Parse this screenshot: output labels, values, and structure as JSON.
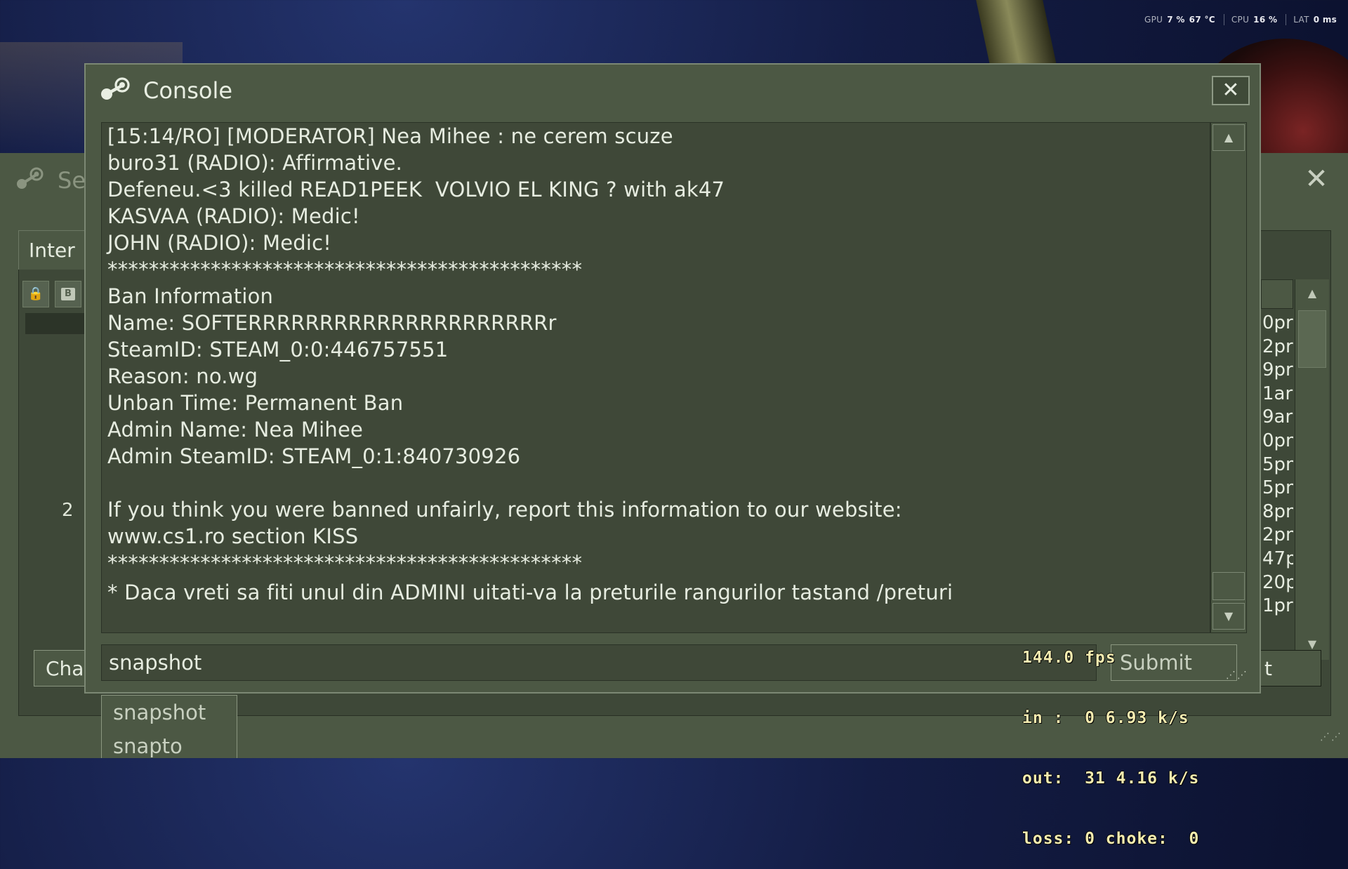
{
  "hud": {
    "gpu_label": "GPU",
    "gpu_value": "7 %",
    "gpu_temp": "67 °C",
    "cpu_label": "CPU",
    "cpu_value": "16 %",
    "lat_label": "LAT",
    "lat_value": "0 ms"
  },
  "server_browser": {
    "title": "Se",
    "tab_label": "Inter",
    "row_number": "2",
    "times": [
      "0pr",
      "2pr",
      "9pr",
      "1ar",
      "9ar",
      "0pn",
      "5pn",
      "5pn",
      "8pn",
      "2pn",
      "47p",
      "20p",
      "1pr"
    ],
    "left_button": "Cha",
    "right_button": "t"
  },
  "console": {
    "title": "Console",
    "close_icon": "close-icon",
    "lines": [
      "[15:14/RO] [MODERATOR] Nea Mihee : ne cerem scuze",
      "buro31 (RADIO): Affirmative.",
      "Defeneu.<3 killed READ1PEEK  VOLVIO EL KING ? with ak47",
      "KASVAA (RADIO): Medic!",
      "JOHN (RADIO): Medic!",
      "**********************************************",
      "Ban Information",
      "Name: SOFTERRRRRRRRRRRRRRRRRRRRRr",
      "SteamID: STEAM_0:0:446757551",
      "Reason: no.wg",
      "Unban Time: Permanent Ban",
      "Admin Name: Nea Mihee",
      "Admin SteamID: STEAM_0:1:840730926",
      "",
      "If you think you were banned unfairly, report this information to our website:",
      "www.cs1.ro section KISS",
      "**********************************************",
      "* Daca vreti sa fiti unul din ADMINI uitati-va la preturile rangurilor tastand /preturi"
    ],
    "input_value": "snapshot",
    "submit_label": "Submit"
  },
  "autocomplete": [
    "snapshot",
    "snapto"
  ],
  "net_graph": {
    "fps": "144.0 fps",
    "in": "in :  0 6.93 k/s",
    "out": "out:  31 4.16 k/s",
    "loss": "loss: 0 choke:  0"
  }
}
